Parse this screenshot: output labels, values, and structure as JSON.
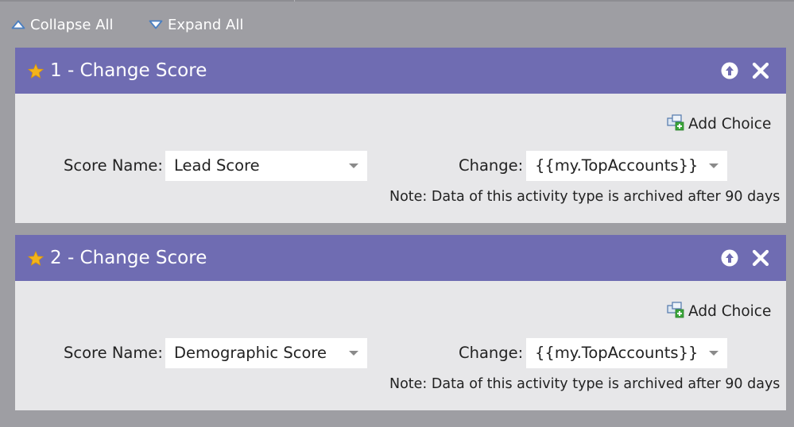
{
  "toolbar": {
    "collapse_all": "Collapse All",
    "expand_all": "Expand All"
  },
  "steps": [
    {
      "title": "1 - Change Score",
      "add_choice": "Add Choice",
      "score_name_label": "Score Name:",
      "score_name_value": "Lead Score",
      "change_label": "Change:",
      "change_value": "{{my.TopAccounts}}",
      "note": "Note: Data of this activity type is archived after 90 days"
    },
    {
      "title": "2 - Change Score",
      "add_choice": "Add Choice",
      "score_name_label": "Score Name:",
      "score_name_value": "Demographic Score",
      "change_label": "Change:",
      "change_value": "{{my.TopAccounts}}",
      "note": "Note: Data of this activity type is archived after 90 days"
    }
  ],
  "icons": {
    "collapse": "triangle-up-icon",
    "expand": "triangle-down-icon",
    "star": "star-icon",
    "move_up": "arrow-up-circle-icon",
    "close": "close-icon",
    "add_choice": "add-choice-icon"
  },
  "colors": {
    "background": "#9e9ea3",
    "header": "#6f6cb2",
    "panel": "#e7e7e9",
    "star": "#f3b41b",
    "add_green": "#3aa53a",
    "toolbar_icon": "#4a7fc1"
  }
}
